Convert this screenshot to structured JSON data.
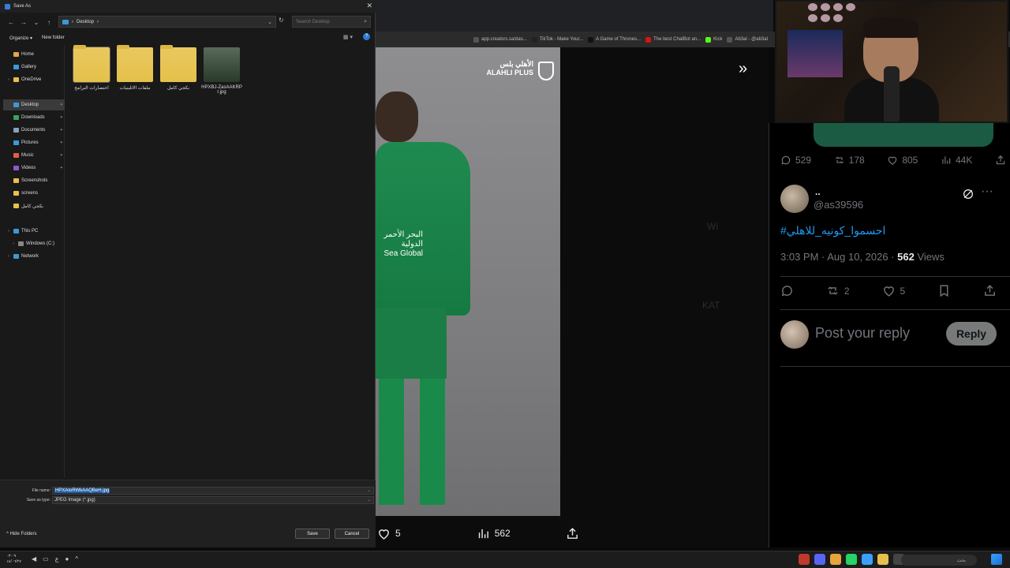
{
  "colors": {
    "accent_blue": "#1d9bf0",
    "dialog_bg": "#191919",
    "selection": "#1f5fa8",
    "jersey_green": "#1f8a4f"
  },
  "dialog": {
    "title": "Save As",
    "address_path": "Desktop",
    "search_placeholder": "Search Desktop",
    "organize_label": "Organize",
    "new_folder_label": "New folder",
    "nav_items": [
      {
        "label": "Home",
        "icon": "home-icon"
      },
      {
        "label": "Gallery",
        "icon": "gallery-icon"
      },
      {
        "label": "OneDrive",
        "icon": "cloud-folder-icon"
      },
      {
        "label": "Desktop",
        "icon": "desktop-icon",
        "selected": true
      },
      {
        "label": "Downloads",
        "icon": "download-icon"
      },
      {
        "label": "Documents",
        "icon": "document-icon"
      },
      {
        "label": "Pictures",
        "icon": "pictures-icon"
      },
      {
        "label": "Music",
        "icon": "music-icon"
      },
      {
        "label": "Videos",
        "icon": "video-icon"
      },
      {
        "label": "Screenshots",
        "icon": "folder-icon"
      },
      {
        "label": "screens",
        "icon": "folder-icon"
      },
      {
        "label": "بكجي كامل",
        "icon": "folder-icon"
      },
      {
        "label": "This PC",
        "icon": "pc-icon"
      },
      {
        "label": "Windows (C:)",
        "icon": "drive-icon"
      },
      {
        "label": "Network",
        "icon": "network-icon"
      }
    ],
    "files": [
      {
        "name": "اختصارات البرامج",
        "type": "folder"
      },
      {
        "name": "ملفات الاثلينيات",
        "type": "folder"
      },
      {
        "name": "بكجي كامل",
        "type": "folder"
      },
      {
        "name": "HPXBJ-ZasAAKRPr.jpg",
        "type": "image"
      }
    ],
    "file_name_label": "File name:",
    "file_name_value": "HPXAIoRWkAAQBeH.jpg",
    "save_type_label": "Save as type:",
    "save_type_value": "JPEG Image (*.jpg)",
    "hide_folders_label": "Hide Folders",
    "save_button": "Save",
    "cancel_button": "Cancel"
  },
  "browser": {
    "bookmarks": [
      {
        "label": "app.creators.sa/das...",
        "color": "#555"
      },
      {
        "label": "TikTok - Make Your...",
        "color": "#222"
      },
      {
        "label": "A Game of Thrones...",
        "color": "#111"
      },
      {
        "label": "The best ChatBot an...",
        "color": "#d11"
      },
      {
        "label": "Kick",
        "color": "#53fc18"
      },
      {
        "label": "Ab3al - @ab3al",
        "color": "#555"
      }
    ],
    "brand_logo_ar": "الأهلي بلس",
    "brand_logo_en": "ALAHLI PLUS",
    "sponsor_ar": "البحر الأحمر الدولية",
    "sponsor_en": "Sea Global",
    "media_likes": "5",
    "media_views": "562"
  },
  "tweet": {
    "stats": {
      "replies": "529",
      "reposts": "178",
      "likes": "805",
      "views": "44K"
    },
    "user_name": "..",
    "user_handle": "@as39596",
    "hashtag": "#احسموا_كونيه_للاهلي",
    "time": "3:03 PM · Aug 10, 2026 · ",
    "views_count": "562",
    "views_label": " Views",
    "actions": {
      "replies": "",
      "reposts": "2",
      "likes": "5"
    },
    "reply_placeholder": "Post your reply",
    "reply_button": "Reply"
  },
  "taskbar": {
    "time": "٠٣:٠٩",
    "date": "١٤/٠٦/٢٧",
    "lang": "ع",
    "search_placeholder": "بحث"
  }
}
